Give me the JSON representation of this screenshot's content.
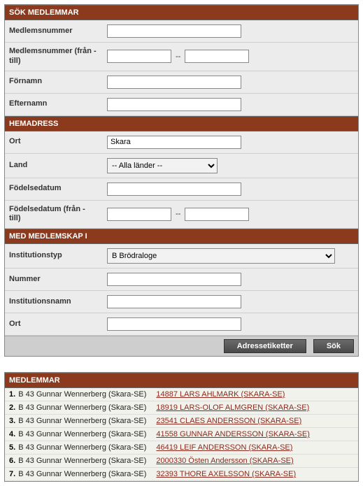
{
  "sections": {
    "search_members": "SÖK MEDLEMMAR",
    "home_address": "HEMADRESS",
    "with_membership": "MED MEDLEMSKAP I",
    "members": "MEDLEMMAR"
  },
  "labels": {
    "medlemsnummer": "Medlemsnummer",
    "medlemsnummer_range": "Medlemsnummer (från - till)",
    "fornamn": "Förnamn",
    "efternamn": "Efternamn",
    "ort": "Ort",
    "land": "Land",
    "fodelsedatum": "Födelsedatum",
    "fodelsedatum_range": "Födelsedatum (från - till)",
    "institutionstyp": "Institutionstyp",
    "nummer": "Nummer",
    "institutionsnamn": "Institutionsnamn",
    "ort2": "Ort",
    "range_sep": "--"
  },
  "values": {
    "ort": "Skara",
    "land_selected": "-- Alla länder --",
    "institutionstyp_selected": "B Brödraloge"
  },
  "buttons": {
    "adressetiketter": "Adressetiketter",
    "sok": "Sök"
  },
  "results": [
    {
      "n": "1.",
      "unit": "B 43 Gunnar Wennerberg (Skara-SE)",
      "link": "14887 LARS AHLMARK (SKARA-SE)"
    },
    {
      "n": "2.",
      "unit": "B 43 Gunnar Wennerberg (Skara-SE)",
      "link": "18919 LARS-OLOF ALMGREN (SKARA-SE)"
    },
    {
      "n": "3.",
      "unit": "B 43 Gunnar Wennerberg (Skara-SE)",
      "link": "23541 CLAES ANDERSSON (SKARA-SE)"
    },
    {
      "n": "4.",
      "unit": "B 43 Gunnar Wennerberg (Skara-SE)",
      "link": "41558 GUNNAR ANDERSSON (SKARA-SE)"
    },
    {
      "n": "5.",
      "unit": "B 43 Gunnar Wennerberg (Skara-SE)",
      "link": "46419 LEIF ANDERSSON (SKARA-SE)"
    },
    {
      "n": "6.",
      "unit": "B 43 Gunnar Wennerberg (Skara-SE)",
      "link": "2000330 Östen Andersson (SKARA-SE)"
    },
    {
      "n": "7.",
      "unit": "B 43 Gunnar Wennerberg (Skara-SE)",
      "link": "32393 THORE AXELSSON (SKARA-SE)"
    }
  ]
}
